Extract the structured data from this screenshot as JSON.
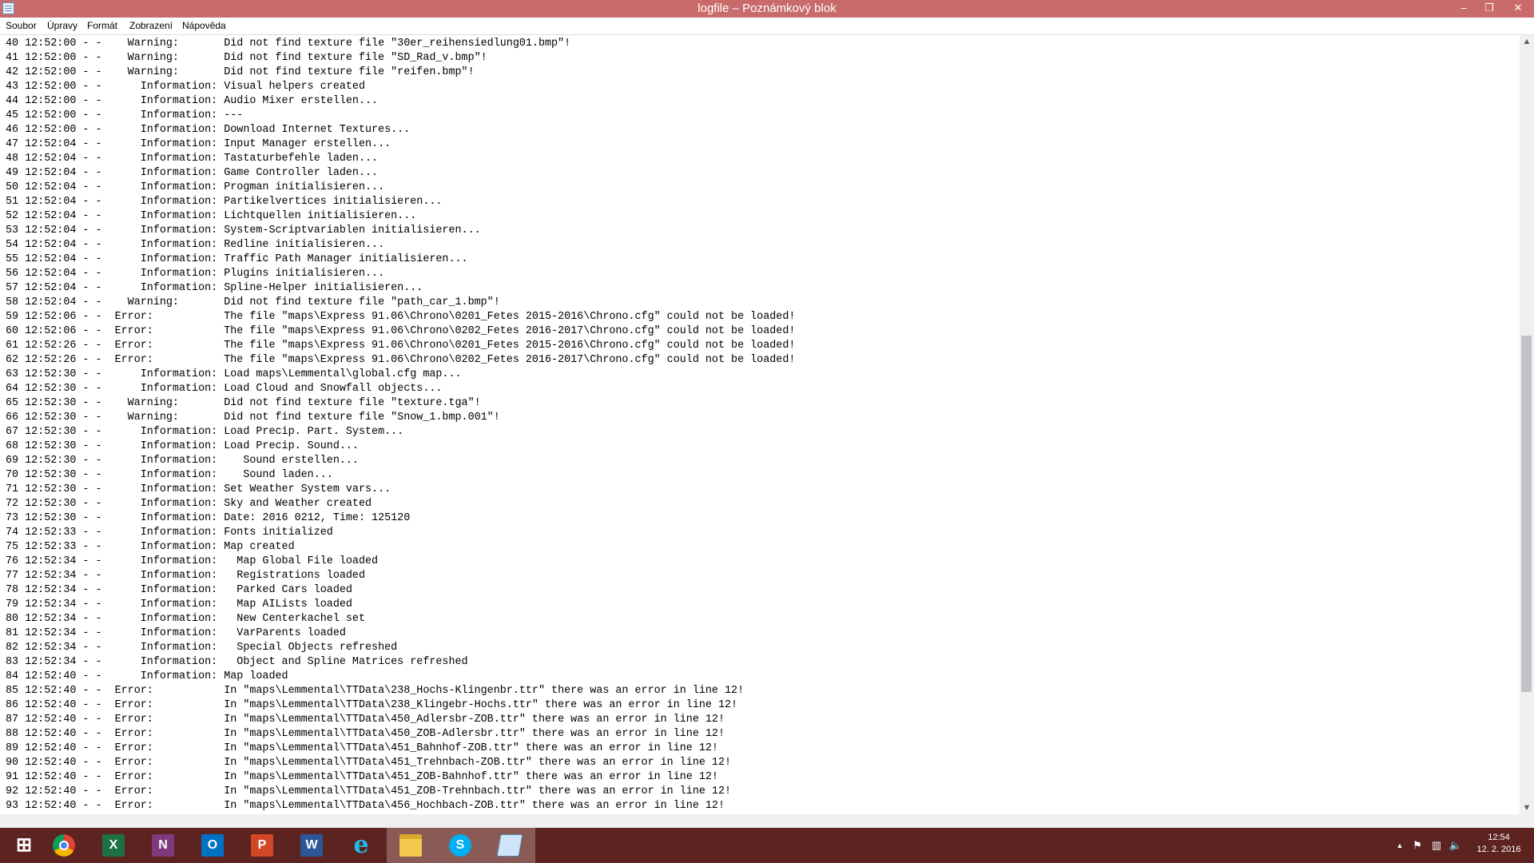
{
  "window": {
    "title": "logfile – Poznámkový blok",
    "icon": "notepad-icon",
    "controls": {
      "minimize": "–",
      "maximize": "❐",
      "close": "✕"
    },
    "accent_color": "#c96b6b"
  },
  "menu": [
    "Soubor",
    "Úpravy",
    "Formát",
    "Zobrazení",
    "Nápověda"
  ],
  "lines": [
    "40 12:52:00 - -    Warning:       Did not find texture file \"30er_reihensiedlung01.bmp\"!",
    "41 12:52:00 - -    Warning:       Did not find texture file \"SD_Rad_v.bmp\"!",
    "42 12:52:00 - -    Warning:       Did not find texture file \"reifen.bmp\"!",
    "43 12:52:00 - -      Information: Visual helpers created",
    "44 12:52:00 - -      Information: Audio Mixer erstellen...",
    "45 12:52:00 - -      Information: ---",
    "46 12:52:00 - -      Information: Download Internet Textures...",
    "47 12:52:04 - -      Information: Input Manager erstellen...",
    "48 12:52:04 - -      Information: Tastaturbefehle laden...",
    "49 12:52:04 - -      Information: Game Controller laden...",
    "50 12:52:04 - -      Information: Progman initialisieren...",
    "51 12:52:04 - -      Information: Partikelvertices initialisieren...",
    "52 12:52:04 - -      Information: Lichtquellen initialisieren...",
    "53 12:52:04 - -      Information: System-Scriptvariablen initialisieren...",
    "54 12:52:04 - -      Information: Redline initialisieren...",
    "55 12:52:04 - -      Information: Traffic Path Manager initialisieren...",
    "56 12:52:04 - -      Information: Plugins initialisieren...",
    "57 12:52:04 - -      Information: Spline-Helper initialisieren...",
    "58 12:52:04 - -    Warning:       Did not find texture file \"path_car_1.bmp\"!",
    "59 12:52:06 - -  Error:           The file \"maps\\Express 91.06\\Chrono\\0201_Fetes 2015-2016\\Chrono.cfg\" could not be loaded!",
    "60 12:52:06 - -  Error:           The file \"maps\\Express 91.06\\Chrono\\0202_Fetes 2016-2017\\Chrono.cfg\" could not be loaded!",
    "61 12:52:26 - -  Error:           The file \"maps\\Express 91.06\\Chrono\\0201_Fetes 2015-2016\\Chrono.cfg\" could not be loaded!",
    "62 12:52:26 - -  Error:           The file \"maps\\Express 91.06\\Chrono\\0202_Fetes 2016-2017\\Chrono.cfg\" could not be loaded!",
    "63 12:52:30 - -      Information: Load maps\\Lemmental\\global.cfg map...",
    "64 12:52:30 - -      Information: Load Cloud and Snowfall objects...",
    "65 12:52:30 - -    Warning:       Did not find texture file \"texture.tga\"!",
    "66 12:52:30 - -    Warning:       Did not find texture file \"Snow_1.bmp.001\"!",
    "67 12:52:30 - -      Information: Load Precip. Part. System...",
    "68 12:52:30 - -      Information: Load Precip. Sound...",
    "69 12:52:30 - -      Information:    Sound erstellen...",
    "70 12:52:30 - -      Information:    Sound laden...",
    "71 12:52:30 - -      Information: Set Weather System vars...",
    "72 12:52:30 - -      Information: Sky and Weather created",
    "73 12:52:30 - -      Information: Date: 2016 0212, Time: 125120",
    "74 12:52:33 - -      Information: Fonts initialized",
    "75 12:52:33 - -      Information: Map created",
    "76 12:52:34 - -      Information:   Map Global File loaded",
    "77 12:52:34 - -      Information:   Registrations loaded",
    "78 12:52:34 - -      Information:   Parked Cars loaded",
    "79 12:52:34 - -      Information:   Map AILists loaded",
    "80 12:52:34 - -      Information:   New Centerkachel set",
    "81 12:52:34 - -      Information:   VarParents loaded",
    "82 12:52:34 - -      Information:   Special Objects refreshed",
    "83 12:52:34 - -      Information:   Object and Spline Matrices refreshed",
    "84 12:52:40 - -      Information: Map loaded",
    "85 12:52:40 - -  Error:           In \"maps\\Lemmental\\TTData\\238_Hochs-Klingenbr.ttr\" there was an error in line 12!",
    "86 12:52:40 - -  Error:           In \"maps\\Lemmental\\TTData\\238_Klingebr-Hochs.ttr\" there was an error in line 12!",
    "87 12:52:40 - -  Error:           In \"maps\\Lemmental\\TTData\\450_Adlersbr-ZOB.ttr\" there was an error in line 12!",
    "88 12:52:40 - -  Error:           In \"maps\\Lemmental\\TTData\\450_ZOB-Adlersbr.ttr\" there was an error in line 12!",
    "89 12:52:40 - -  Error:           In \"maps\\Lemmental\\TTData\\451_Bahnhof-ZOB.ttr\" there was an error in line 12!",
    "90 12:52:40 - -  Error:           In \"maps\\Lemmental\\TTData\\451_Trehnbach-ZOB.ttr\" there was an error in line 12!",
    "91 12:52:40 - -  Error:           In \"maps\\Lemmental\\TTData\\451_ZOB-Bahnhof.ttr\" there was an error in line 12!",
    "92 12:52:40 - -  Error:           In \"maps\\Lemmental\\TTData\\451_ZOB-Trehnbach.ttr\" there was an error in line 12!",
    "93 12:52:40 - -  Error:           In \"maps\\Lemmental\\TTData\\456_Hochbach-ZOB.ttr\" there was an error in line 12!"
  ],
  "scrollbar": {
    "up_arrow": "▲",
    "down_arrow": "▼"
  },
  "taskbar": {
    "start_glyph": "⊞",
    "apps": [
      {
        "name": "chrome-icon",
        "glyph": ""
      },
      {
        "name": "excel-icon",
        "glyph": "X"
      },
      {
        "name": "onenote-icon",
        "glyph": "N"
      },
      {
        "name": "outlook-icon",
        "glyph": "O"
      },
      {
        "name": "powerpoint-icon",
        "glyph": "P"
      },
      {
        "name": "word-icon",
        "glyph": "W"
      },
      {
        "name": "internet-explorer-icon",
        "glyph": "e"
      },
      {
        "name": "file-explorer-icon",
        "glyph": ""
      },
      {
        "name": "skype-icon",
        "glyph": "S"
      },
      {
        "name": "notepad-icon",
        "glyph": ""
      }
    ],
    "tray": {
      "chevron": "▲",
      "flag": "⚑",
      "network": "▥",
      "volume": "🔈"
    },
    "clock_time": "12:54",
    "clock_date": "12. 2. 2016",
    "color": "#5c2320"
  }
}
